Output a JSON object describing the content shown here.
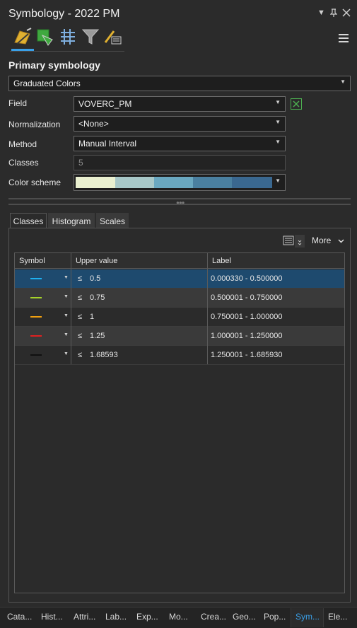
{
  "window": {
    "title": "Symbology - 2022 PM"
  },
  "section": {
    "title": "Primary symbology"
  },
  "renderer": {
    "value": "Graduated Colors"
  },
  "fields": {
    "field_label": "Field",
    "field_value": "VOVERC_PM",
    "normalization_label": "Normalization",
    "normalization_value": "<None>",
    "method_label": "Method",
    "method_value": "Manual Interval",
    "classes_label": "Classes",
    "classes_value": "5",
    "color_scheme_label": "Color scheme",
    "color_scheme_colors": [
      "#eaf0d0",
      "#a8c8c8",
      "#6aa8c0",
      "#4a80a0",
      "#3a6890"
    ]
  },
  "tabs": [
    "Classes",
    "Histogram",
    "Scales"
  ],
  "grid_toolbar": {
    "more_label": "More"
  },
  "grid": {
    "headers": [
      "Symbol",
      "Upper value",
      "Label"
    ],
    "rows": [
      {
        "le": "≤",
        "upper_value": "0.5",
        "label": "0.000330 - 0.500000",
        "color": "#1fb0f0",
        "row_bg": "#1e4a6e"
      },
      {
        "le": "≤",
        "upper_value": "0.75",
        "label": "0.500001 - 0.750000",
        "color": "#a6d32a",
        "row_bg": "#3a3a3a"
      },
      {
        "le": "≤",
        "upper_value": "1",
        "label": "0.750001 - 1.000000",
        "color": "#f0a010",
        "row_bg": "#2b2b2b"
      },
      {
        "le": "≤",
        "upper_value": "1.25",
        "label": "1.000001 - 1.250000",
        "color": "#e02020",
        "row_bg": "#3a3a3a"
      },
      {
        "le": "≤",
        "upper_value": "1.68593",
        "label": "1.250001 - 1.685930",
        "color": "#101010",
        "row_bg": "#2b2b2b"
      }
    ]
  },
  "bottom_tabs": [
    "Cata...",
    "Hist...",
    "Attri...",
    "Lab...",
    "Exp...",
    "Mo...",
    "Crea...",
    "Geo...",
    "Pop...",
    "Sym...",
    "Ele..."
  ],
  "active_bottom_tab": "Sym..."
}
